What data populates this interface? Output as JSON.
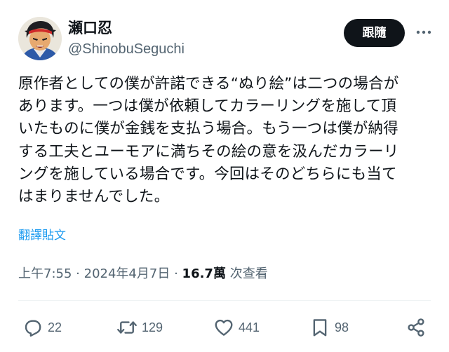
{
  "author": {
    "display_name": "瀬口忍",
    "handle": "@ShinobuSeguchi",
    "avatar_icon": "manga-character-avatar"
  },
  "follow_label": "跟隨",
  "more_icon": "more-horizontal-icon",
  "tweet": {
    "lines": [
      "原作者としての僕が許諾できる“ぬり絵”は二つの場合が",
      "あります。一つは僕が依頼してカラーリングを施して頂",
      "いたものに僕が金銭を支払う場合。もう一つは僕が納得",
      "する工夫とユーモアに満ちその絵の意を汲んだカラーリ",
      "ングを施している場合です。今回はそのどちらにも当て",
      "はまりませんでした。"
    ]
  },
  "translate_label": "翻譯貼文",
  "meta": {
    "time": "上午7:55",
    "separator": "·",
    "date": "2024年4月7日",
    "views_count": "16.7萬",
    "views_label": "次查看"
  },
  "actions": {
    "reply_count": "22",
    "retweet_count": "129",
    "like_count": "441",
    "bookmark_count": "98"
  },
  "colors": {
    "text": "#0f1419",
    "secondary": "#536471",
    "link": "#1d9bf0",
    "button_bg": "#0f1419"
  }
}
